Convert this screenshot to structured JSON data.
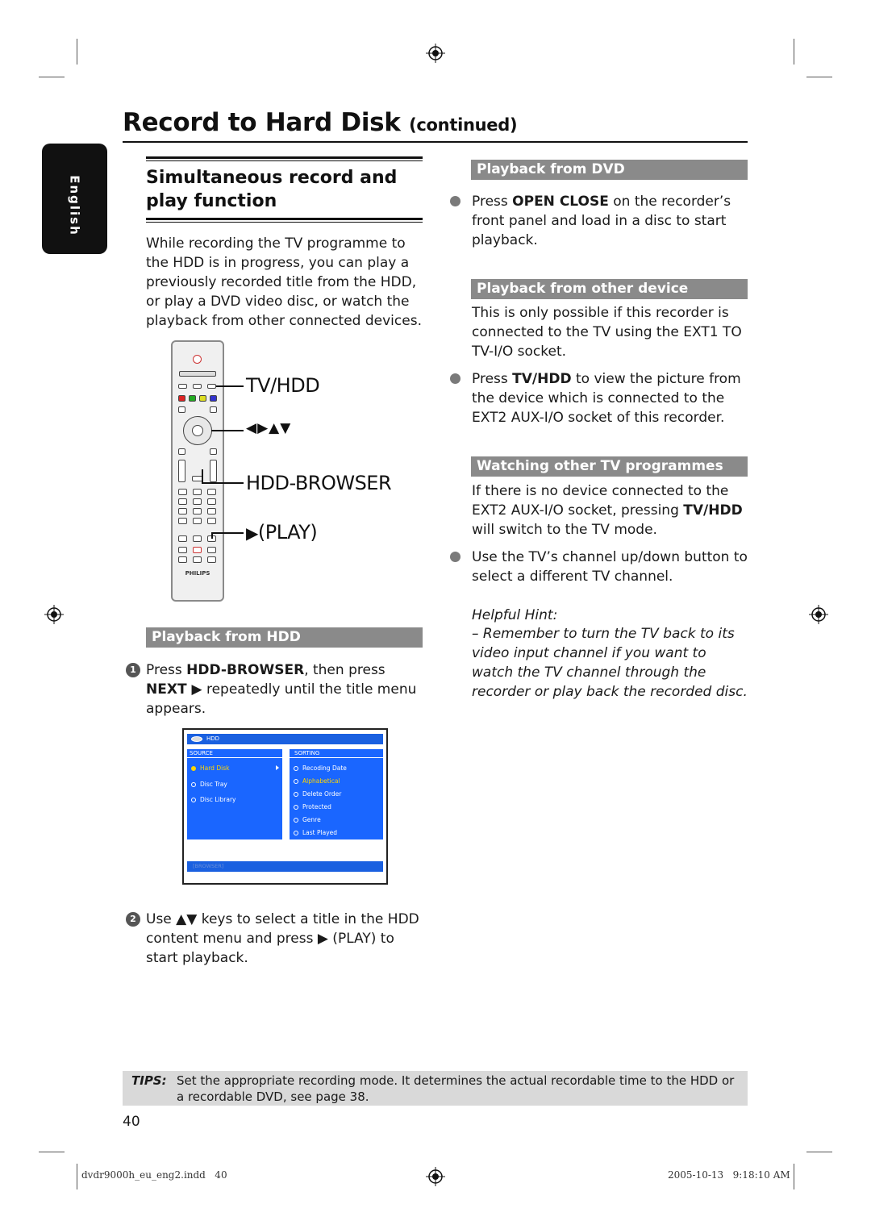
{
  "header": {
    "title": "Record to Hard Disk",
    "title_suffix": "(continued)"
  },
  "language_tab": "English",
  "section": {
    "title": "Simultaneous record and play function",
    "intro": "While recording the TV programme to the HDD is in progress, you can play a previously recorded title from the HDD, or play a DVD video disc, or watch the playback from other connected devices."
  },
  "remote": {
    "brand": "PHILIPS",
    "callouts": {
      "tv_hdd": "TV/HDD",
      "arrows": "◀▶▲▼",
      "hdd_browser": "HDD-BROWSER",
      "play_icon": "▶",
      "play": "(PLAY)"
    }
  },
  "playback_hdd": {
    "heading": "Playback from HDD",
    "step1": {
      "num": "1",
      "pre": "Press ",
      "key1": "HDD-BROWSER",
      "mid": ", then press ",
      "key2": "NEXT ▶",
      "post": " repeatedly until the title menu appears."
    },
    "step2": {
      "num": "2",
      "text": "Use ▲▼ keys to select a title in the HDD content menu and press ▶ (PLAY) to start playback."
    }
  },
  "hdd_screen": {
    "header": "HDD",
    "source_label": "SOURCE",
    "source_items": [
      {
        "label": "Hard Disk",
        "selected": true
      },
      {
        "label": "Disc Tray",
        "selected": false
      },
      {
        "label": "Disc Library",
        "selected": false
      }
    ],
    "sorting_label": "SORTING",
    "sorting_items": [
      {
        "label": "Recoding Date",
        "selected": false
      },
      {
        "label": "Alphabetical",
        "selected": true
      },
      {
        "label": "Delete Order",
        "selected": false
      },
      {
        "label": "Protected",
        "selected": false
      },
      {
        "label": "Genre",
        "selected": false
      },
      {
        "label": "Last Played",
        "selected": false
      }
    ],
    "footer": "[BROWSER]"
  },
  "playback_dvd": {
    "heading": "Playback from DVD",
    "pre": "Press ",
    "key": "OPEN CLOSE",
    "post": " on the recorder’s front panel and load in a disc to start playback."
  },
  "playback_other": {
    "heading": "Playback from other device",
    "intro": "This is only possible if this recorder is connected to the TV using the EXT1 TO TV-I/O socket.",
    "pre": "Press ",
    "key": "TV/HDD",
    "post": " to view the picture from the device which is connected to the EXT2 AUX-I/O socket of this recorder."
  },
  "watching_other": {
    "heading": "Watching other TV programmes",
    "pre": "If there is no device connected to the EXT2 AUX-I/O socket, pressing ",
    "key": "TV/HDD",
    "post": " will switch to the TV mode.",
    "bullet": "Use the TV’s channel up/down button to select a different TV channel."
  },
  "hint": {
    "title": "Helpful Hint:",
    "text": "– Remember to turn the TV back to its video input channel if you want to watch the TV channel through the recorder or play back the recorded disc."
  },
  "tips": {
    "label": "TIPS:",
    "text": "Set the appropriate recording mode. It determines the actual recordable time to the HDD or a recordable DVD, see page 38."
  },
  "page_number": "40",
  "footer": {
    "file": "dvdr9000h_eu_eng2.indd   40",
    "timestamp": "2005-10-13   9:18:10 AM"
  }
}
